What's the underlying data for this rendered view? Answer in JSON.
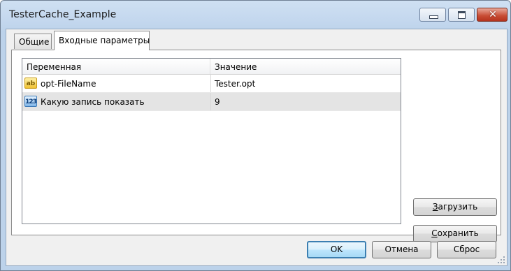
{
  "window": {
    "title": "TesterCache_Example"
  },
  "tabs": [
    {
      "label": "Общие",
      "active": false
    },
    {
      "label": "Входные параметры",
      "active": true
    }
  ],
  "grid": {
    "columns": [
      "Переменная",
      "Значение"
    ],
    "rows": [
      {
        "icon": "string-type-icon",
        "icon_text": "ab",
        "variable": "opt-FileName",
        "value": "Tester.opt"
      },
      {
        "icon": "integer-type-icon",
        "icon_text": "123",
        "variable": "Какую запись показать",
        "value": "9"
      }
    ]
  },
  "side_buttons": {
    "load_mnemonic": "З",
    "load_rest": "агрузить",
    "save_mnemonic": "С",
    "save_rest": "охранить"
  },
  "dialog_buttons": {
    "ok": "OK",
    "cancel": "Отмена",
    "reset": "Сброс"
  },
  "colors": {
    "title_bar": "#c3d7ee",
    "close_button": "#c74b33",
    "selected_row": "#e4e4e4",
    "default_button_border": "#3c7fb1"
  }
}
